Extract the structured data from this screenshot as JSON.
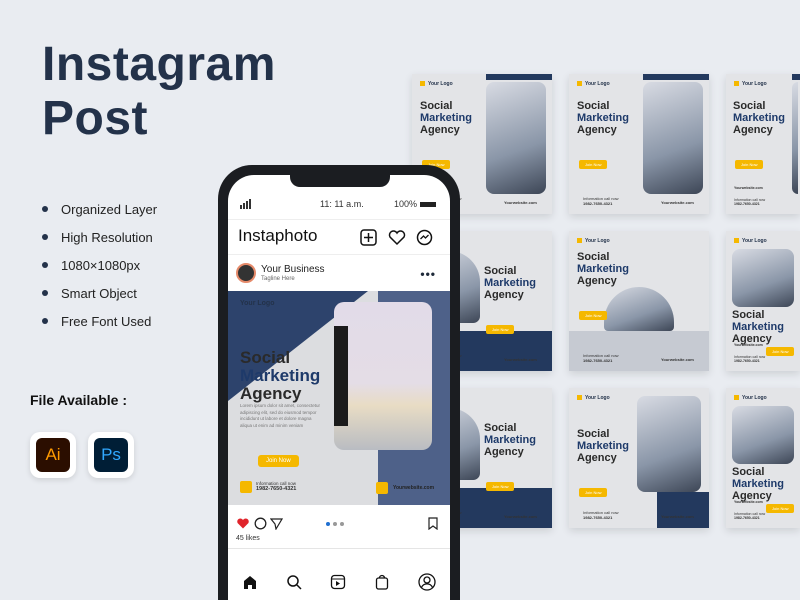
{
  "hero": {
    "title_line1": "Instagram",
    "title_line2": "Post"
  },
  "features": [
    "Organized Layer",
    "High Resolution",
    "1080×1080px",
    "Smart Object",
    "Free Font Used"
  ],
  "file_available": {
    "label": "File Available :",
    "apps": [
      {
        "name": "Ai",
        "bg": "#2b0e00",
        "fg": "#ff9a00"
      },
      {
        "name": "Ps",
        "bg": "#001e36",
        "fg": "#31a8ff"
      }
    ]
  },
  "phone": {
    "time": "11: 11 a.m.",
    "battery": "100%",
    "app_name": "Instaphoto",
    "account": {
      "name": "Your Business",
      "tagline": "Tagline Here"
    },
    "post": {
      "logo": "Your Logo",
      "line1": "Social",
      "line2": "Marketing",
      "line3": "Agency",
      "body": "Lorem ipsum dolor sit amet, consectetur adipiscing elit, sed do eiusmod tempor incididunt ut labore et dolore magna aliqua ut enim ad minim veniam",
      "cta": "Join Now",
      "info_label": "Information call now",
      "phone": "1982-7650-4321",
      "website": "Yourwebsite.com"
    },
    "likes": "45 likes"
  },
  "colors": {
    "navy": "#23395e",
    "accent": "#f5b800",
    "heart": "#e0242b",
    "dot_active": "#1f6fd1"
  },
  "card_text": {
    "logo": "Your Logo",
    "line1": "Social",
    "line2": "Marketing",
    "line3": "Agency",
    "cta": "Join Now",
    "info_label": "Information call now",
    "phone": "1982-7650-4321",
    "website": "Yourwebsite.com"
  },
  "cards": [
    {
      "layout": "right"
    },
    {
      "layout": "right"
    },
    {
      "layout": "right"
    },
    {
      "layout": "left"
    },
    {
      "layout": "center"
    },
    {
      "layout": "top"
    },
    {
      "layout": "left"
    },
    {
      "layout": "right-band"
    },
    {
      "layout": "top"
    }
  ]
}
